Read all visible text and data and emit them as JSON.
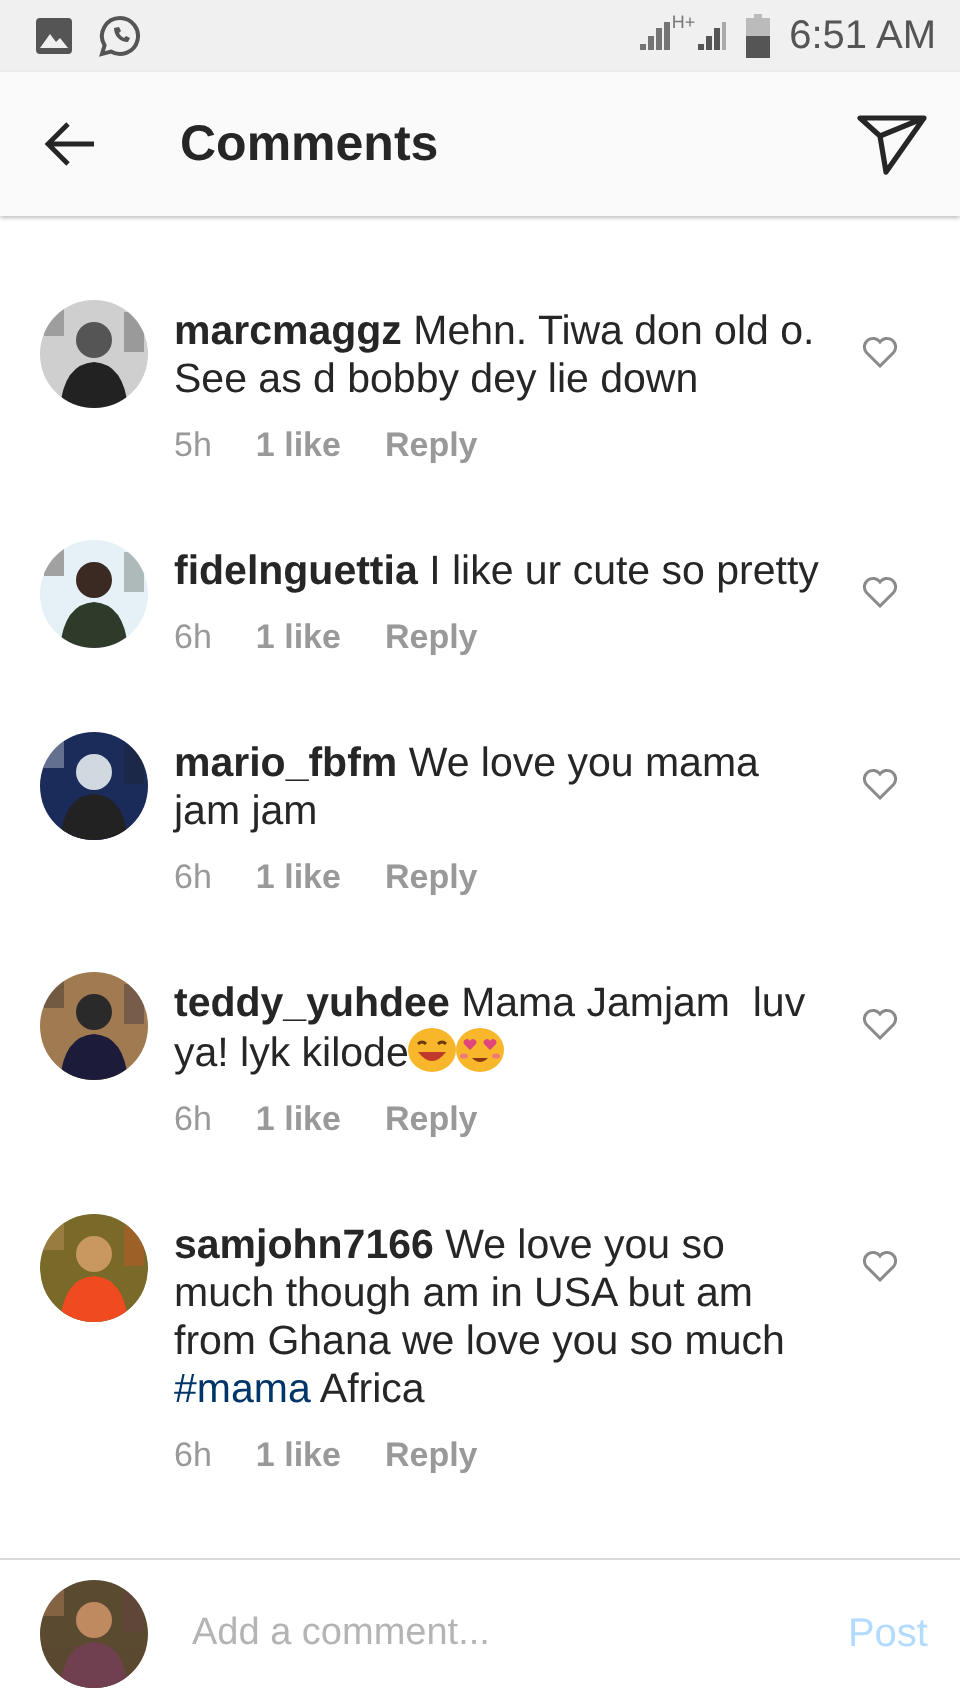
{
  "status_bar": {
    "network": "H+",
    "time": "6:51 AM"
  },
  "header": {
    "title": "Comments"
  },
  "comments": [
    {
      "username": "marcmaggz",
      "parts": [
        {
          "kind": "text",
          "text": "Mehn. Tiwa don old o. See as d bobby dey lie down"
        }
      ],
      "time": "5h",
      "likes": "1 like",
      "reply": "Reply",
      "liked": false
    },
    {
      "username": "fidelnguettia",
      "parts": [
        {
          "kind": "text",
          "text": "I like ur cute so pretty"
        }
      ],
      "time": "6h",
      "likes": "1 like",
      "reply": "Reply",
      "liked": false
    },
    {
      "username": "mario_fbfm",
      "parts": [
        {
          "kind": "text",
          "text": "We love you mama jam jam"
        }
      ],
      "time": "6h",
      "likes": "1 like",
      "reply": "Reply",
      "liked": false
    },
    {
      "username": "teddy_yuhdee",
      "parts": [
        {
          "kind": "text",
          "text": "Mama Jamjam  luv ya! lyk kilode"
        },
        {
          "kind": "smile_emoji"
        },
        {
          "kind": "heart_eyes_emoji"
        }
      ],
      "time": "6h",
      "likes": "1 like",
      "reply": "Reply",
      "liked": false
    },
    {
      "username": "samjohn7166",
      "parts": [
        {
          "kind": "text",
          "text": "We love you so much though am in USA but am from Ghana we love you so much "
        },
        {
          "kind": "hashtag",
          "text": "#mama"
        },
        {
          "kind": "text",
          "text": " Africa"
        }
      ],
      "time": "6h",
      "likes": "1 like",
      "reply": "Reply",
      "liked": false
    }
  ],
  "composer": {
    "placeholder": "Add a comment...",
    "post": "Post"
  }
}
